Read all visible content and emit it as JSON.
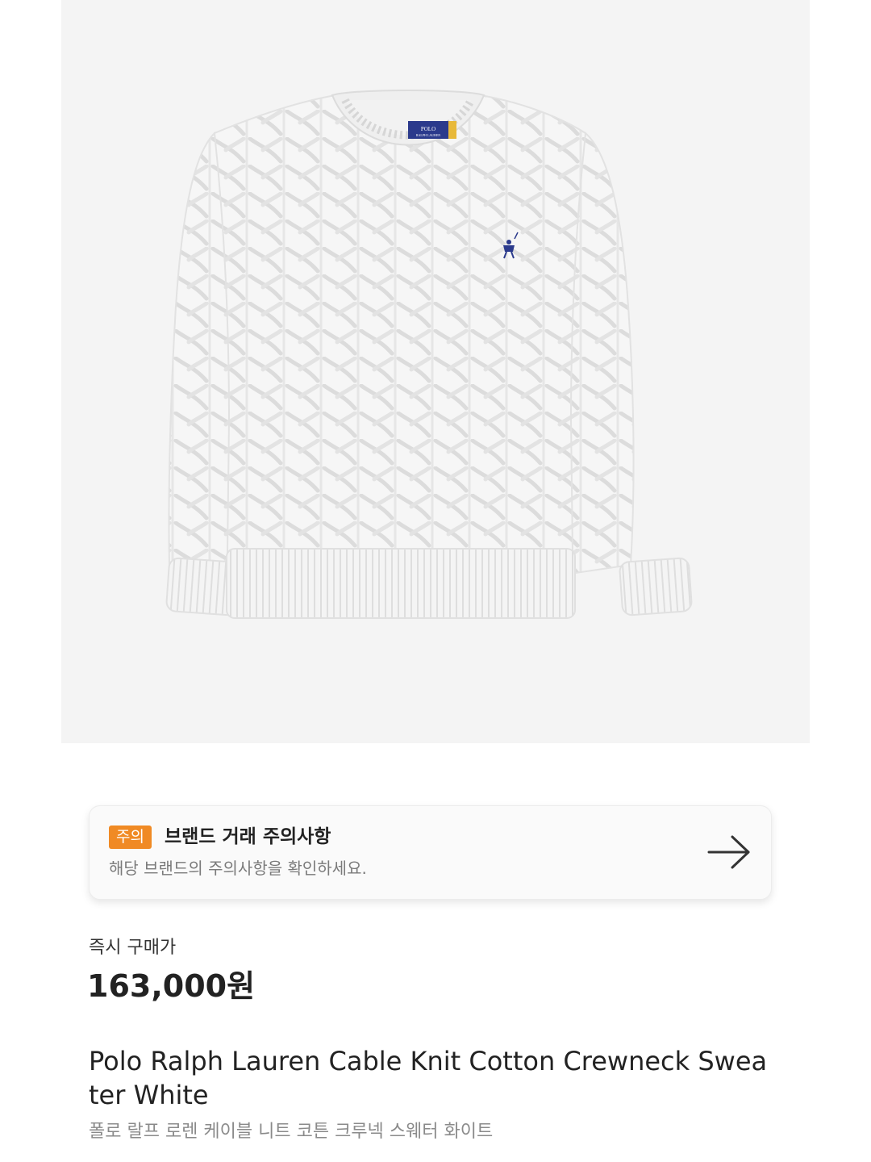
{
  "notice": {
    "badge": "주의",
    "title": "브랜드 거래 주의사항",
    "description": "해당 브랜드의 주의사항을 확인하세요.",
    "badge_color": "#f08a24",
    "arrow_icon": "arrow-right-icon"
  },
  "price": {
    "label": "즉시 구매가",
    "value": "163,000원"
  },
  "product": {
    "name_en": "Polo Ralph Lauren Cable Knit Cotton Crewneck Sweater White",
    "name_ko": "폴로 랄프 로렌 케이블 니트 코튼 크루넥 스웨터 화이트",
    "image_icon": "white-cable-knit-sweater-image",
    "label_text_line1": "POLO",
    "label_text_line2": "RALPH LAUREN"
  },
  "colors": {
    "image_bg": "#f4f4f4",
    "accent": "#f08a24",
    "logo_blue": "#2b3a8c"
  }
}
